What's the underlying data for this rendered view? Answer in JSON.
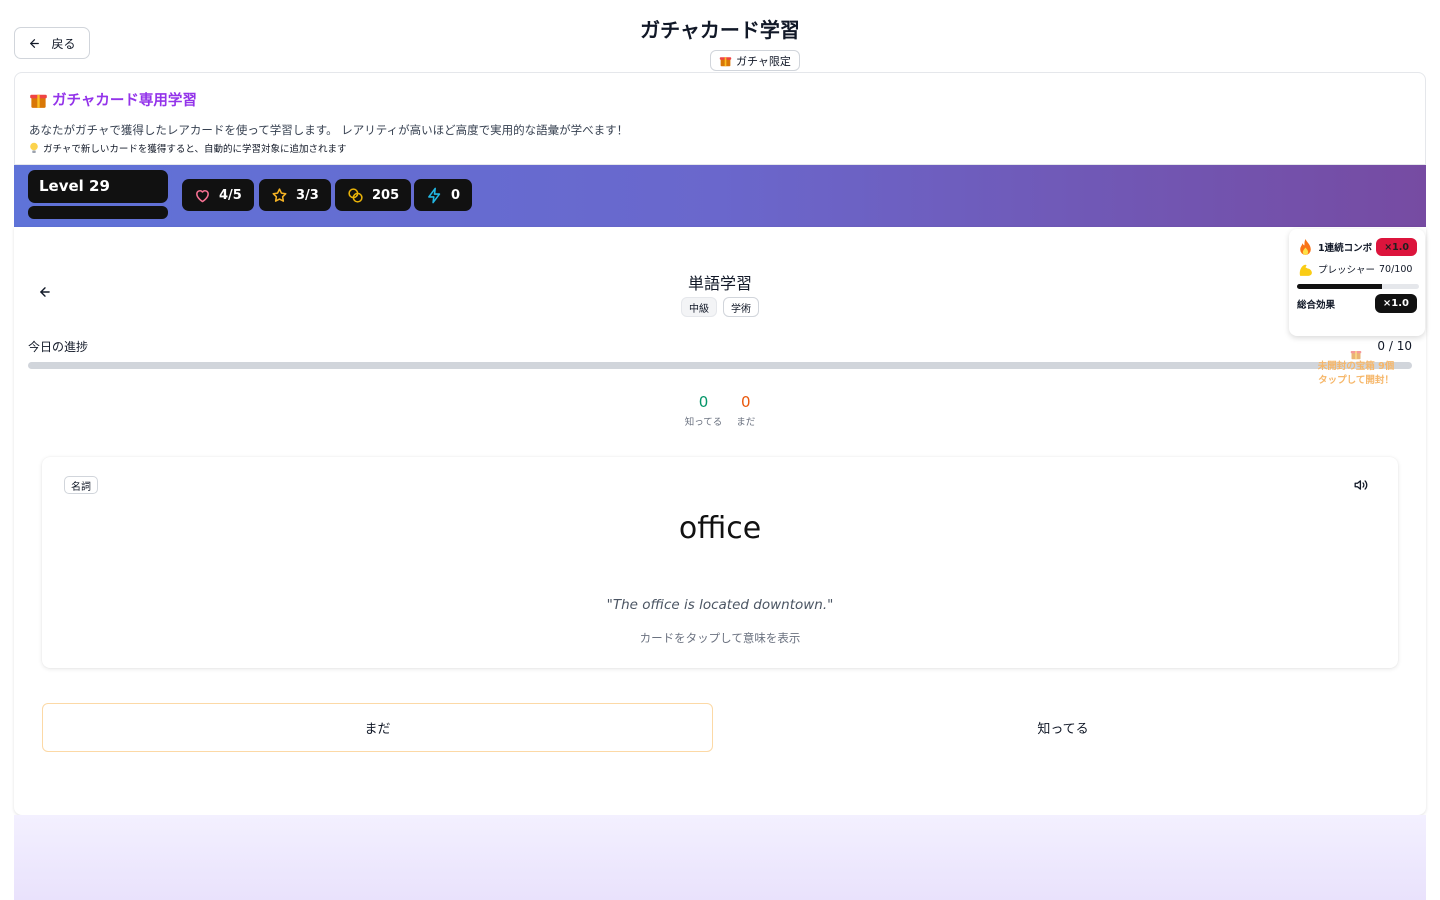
{
  "header": {
    "back_label": "戻る",
    "title": "ガチャカード学習",
    "badge": "ガチャ限定"
  },
  "info": {
    "title": "ガチャカード専用学習",
    "description": "あなたがガチャで獲得したレアカードを使って学習します。 レアリティが高いほど高度で実用的な語彙が学べます！",
    "tip": "ガチャで新しいカードを獲得すると、自動的に学習対象に追加されます"
  },
  "status": {
    "level": "Level 29",
    "hearts": "4/5",
    "stars": "3/3",
    "coins": "205",
    "energy": "0"
  },
  "session": {
    "title": "単語学習",
    "tags": [
      "中級",
      "学術"
    ],
    "progress_label": "今日の進捗",
    "progress_count": "0 / 10",
    "progress_value": 0,
    "known_count": "0",
    "known_label": "知ってる",
    "unknown_count": "0",
    "unknown_label": "まだ"
  },
  "card": {
    "pos": "名詞",
    "word": "office",
    "example": "\"The office is located downtown.\"",
    "hint": "カードをタップして意味を表示"
  },
  "actions": {
    "unknown_label": "まだ",
    "known_label": "知ってる"
  },
  "combo": {
    "combo_label": "1連続コンボ",
    "combo_multiplier": "×1.0",
    "pressure_label": "プレッシャー",
    "pressure_value": "70/100",
    "pressure_fraction": 0.7,
    "effect_label": "総合効果",
    "effect_multiplier": "×1.0"
  },
  "treasure": {
    "line1": "未開封の宝箱 9個",
    "line2": "タップして開封！"
  },
  "colors": {
    "accent_purple": "#9333ea",
    "banner_start": "#5f73d8",
    "banner_end": "#764ba2",
    "known_green": "#059669",
    "unknown_orange": "#ea580c",
    "combo_red": "#dc143c",
    "treasure_orange": "#f6b76a"
  }
}
